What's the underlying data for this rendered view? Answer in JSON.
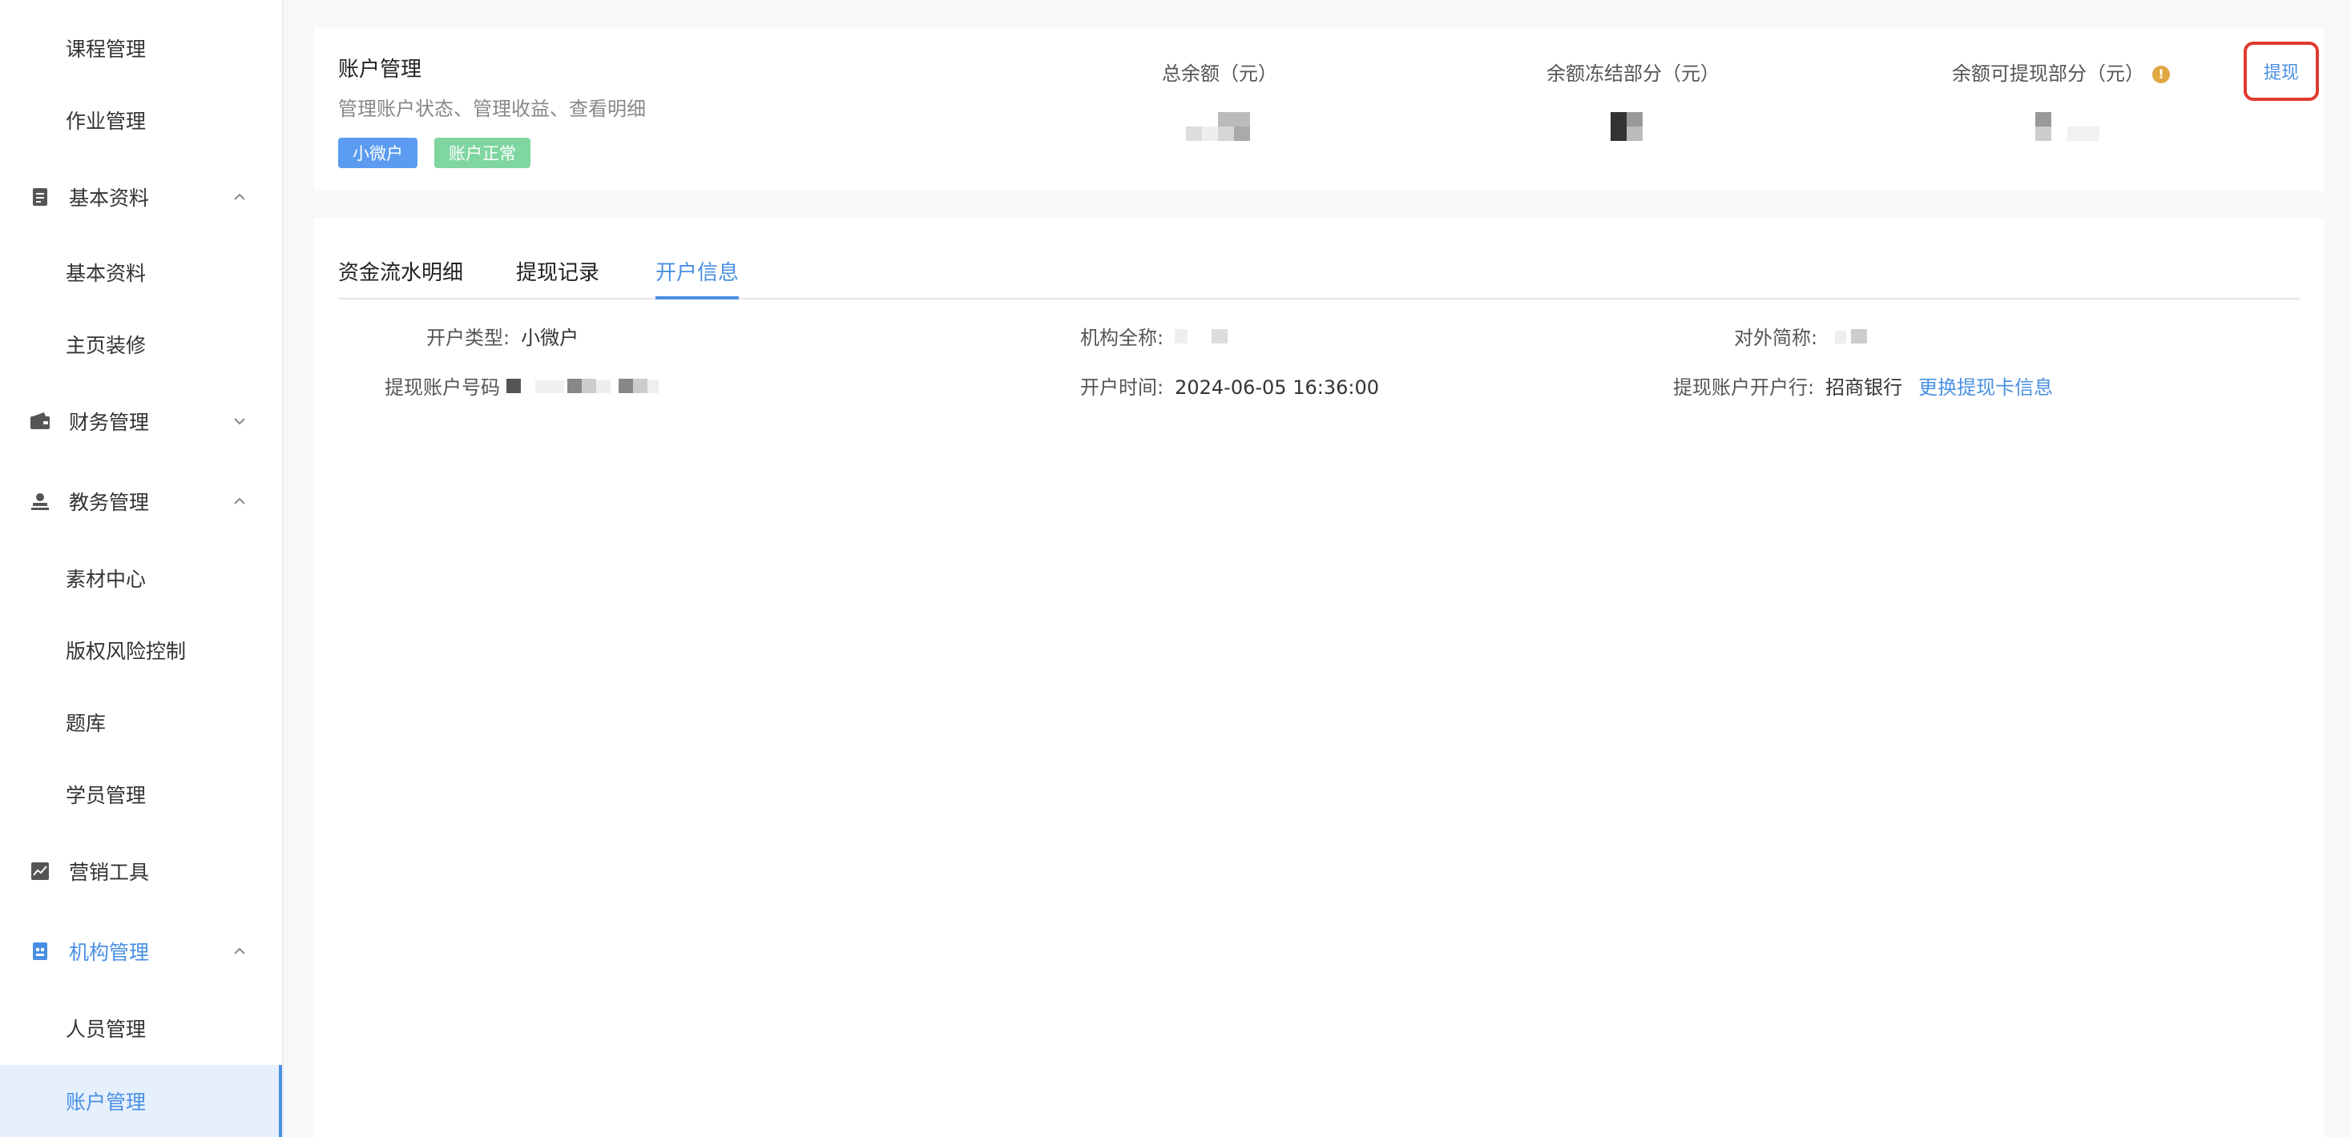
{
  "sidebar": {
    "items": [
      {
        "label": "课程管理"
      },
      {
        "label": "作业管理"
      },
      {
        "label": "基本资料"
      },
      {
        "label": "基本资料"
      },
      {
        "label": "主页装修"
      },
      {
        "label": "财务管理"
      },
      {
        "label": "教务管理"
      },
      {
        "label": "素材中心"
      },
      {
        "label": "版权风险控制"
      },
      {
        "label": "题库"
      },
      {
        "label": "学员管理"
      },
      {
        "label": "营销工具"
      },
      {
        "label": "机构管理"
      },
      {
        "label": "人员管理"
      },
      {
        "label": "账户管理"
      }
    ]
  },
  "account": {
    "title": "账户管理",
    "subtitle": "管理账户状态、管理收益、查看明细",
    "tags": [
      "小微户",
      "账户正常"
    ],
    "stats": {
      "total_label": "总余额（元）",
      "frozen_label": "余额冻结部分（元）",
      "withdrawable_label": "余额可提现部分（元）"
    },
    "withdraw_label": "提现"
  },
  "tabs": [
    {
      "label": "资金流水明细"
    },
    {
      "label": "提现记录"
    },
    {
      "label": "开户信息"
    }
  ],
  "info": {
    "open_type_label": "开户类型:",
    "open_type_value": "小微户",
    "org_name_label": "机构全称:",
    "short_name_label": "对外简称:",
    "withdraw_account_label": "提现账户号码",
    "open_time_label": "开户时间:",
    "open_time_value": "2024-06-05 16:36:00",
    "bank_label": "提现账户开户行:",
    "bank_value": "招商银行",
    "change_card_label": "更换提现卡信息"
  },
  "colors": {
    "accent": "#4a90e2",
    "tag_blue": "#5b9cf0",
    "tag_green": "#7fd6a0",
    "highlight_red": "#e03b2f",
    "warning": "#e0a941"
  }
}
